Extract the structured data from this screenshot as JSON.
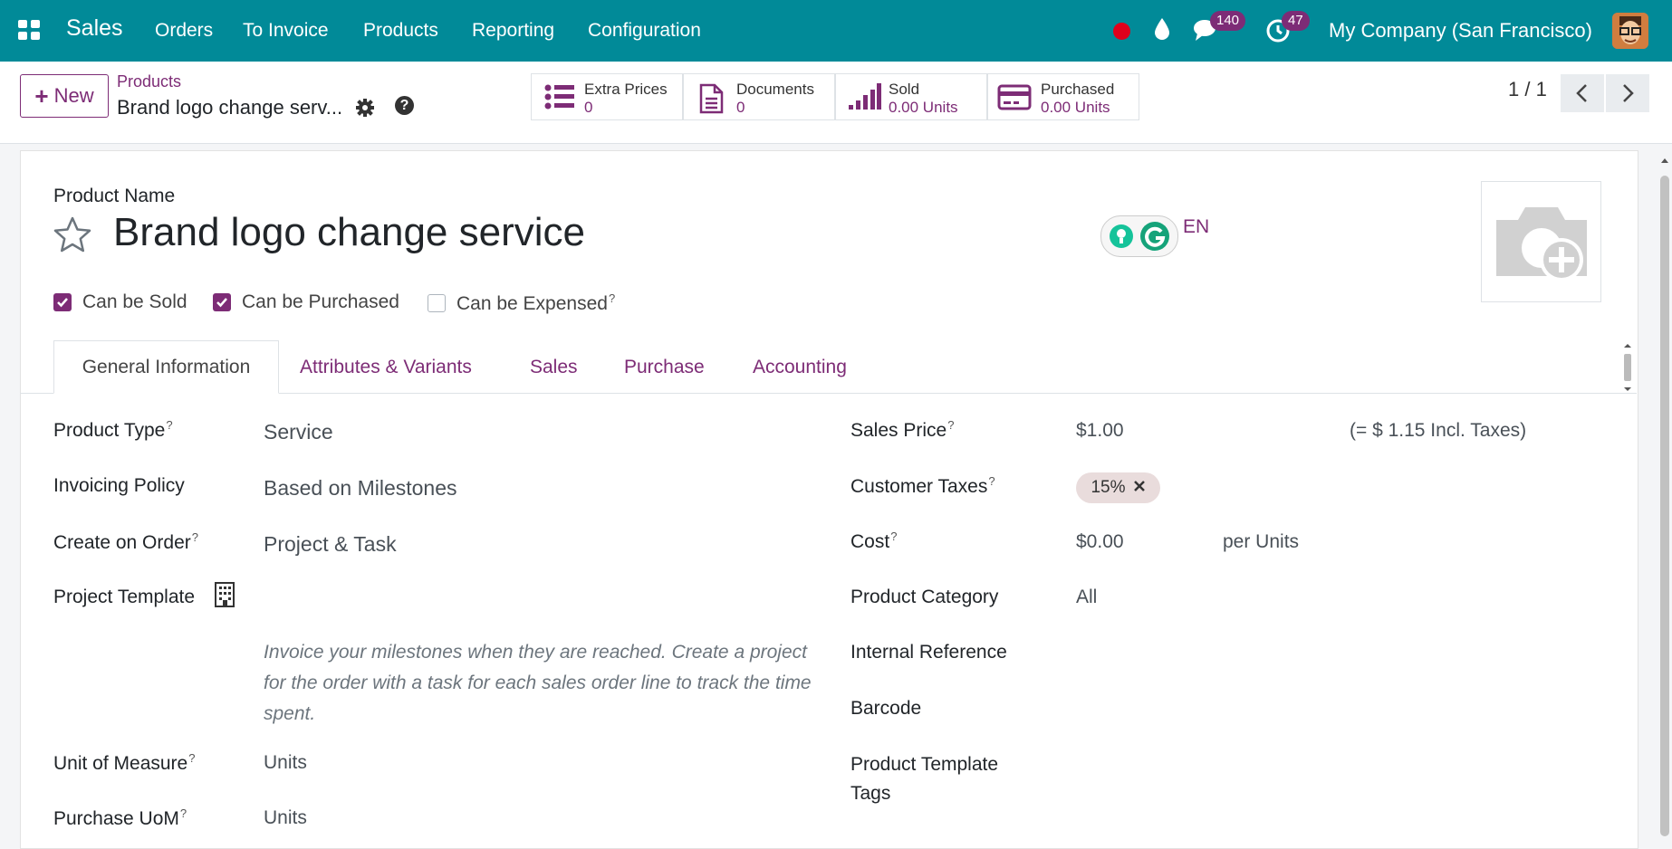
{
  "navbar": {
    "brand": "Sales",
    "menu": [
      "Orders",
      "To Invoice",
      "Products",
      "Reporting",
      "Configuration"
    ],
    "messages_badge": "140",
    "activities_badge": "47",
    "company": "My Company (San Francisco)"
  },
  "control_panel": {
    "new_label": "New",
    "breadcrumb_parent": "Products",
    "breadcrumb_current": "Brand logo change serv...",
    "help_glyph": "?",
    "smart_buttons": [
      {
        "title": "Extra Prices",
        "value": "0",
        "icon": "list-icon"
      },
      {
        "title": "Documents",
        "value": "0",
        "icon": "document-icon"
      },
      {
        "title": "Sold",
        "value": "0.00 Units",
        "icon": "bar-chart-icon"
      },
      {
        "title": "Purchased",
        "value": "0.00 Units",
        "icon": "credit-card-icon"
      }
    ],
    "pager": "1 / 1"
  },
  "form": {
    "product_name_label": "Product Name",
    "product_name": "Brand logo change service",
    "lang": "EN",
    "checkboxes": [
      {
        "label": "Can be Sold",
        "checked": true,
        "help": ""
      },
      {
        "label": "Can be Purchased",
        "checked": true,
        "help": ""
      },
      {
        "label": "Can be Expensed",
        "checked": false,
        "help": "?"
      }
    ],
    "tabs": [
      "General Information",
      "Attributes & Variants",
      "Sales",
      "Purchase",
      "Accounting"
    ],
    "help_mark": "?",
    "left": {
      "product_type_label": "Product Type",
      "product_type": "Service",
      "invoicing_policy_label": "Invoicing Policy",
      "invoicing_policy": "Based on Milestones",
      "create_on_order_label": "Create on Order",
      "create_on_order": "Project & Task",
      "project_template_label": "Project Template",
      "description": "Invoice your milestones when they are reached. Create a project for the order with a task for each sales order line to track the time spent.",
      "uom_label": "Unit of Measure",
      "uom": "Units",
      "purchase_uom_label": "Purchase UoM",
      "purchase_uom": "Units"
    },
    "right": {
      "sales_price_label": "Sales Price",
      "sales_price": "$1.00",
      "incl_taxes": "(= $ 1.15 Incl. Taxes)",
      "customer_taxes_label": "Customer Taxes",
      "customer_tax_tag": "15%",
      "cost_label": "Cost",
      "cost": "$0.00",
      "cost_unit": "per Units",
      "category_label": "Product Category",
      "category": "All",
      "internal_ref_label": "Internal Reference",
      "barcode_label": "Barcode",
      "template_tags_label_1": "Product Template",
      "template_tags_label_2": "Tags"
    }
  },
  "colors": {
    "navbar": "#018a98",
    "accent": "#7d2c76",
    "record_dot": "#e0001b"
  }
}
